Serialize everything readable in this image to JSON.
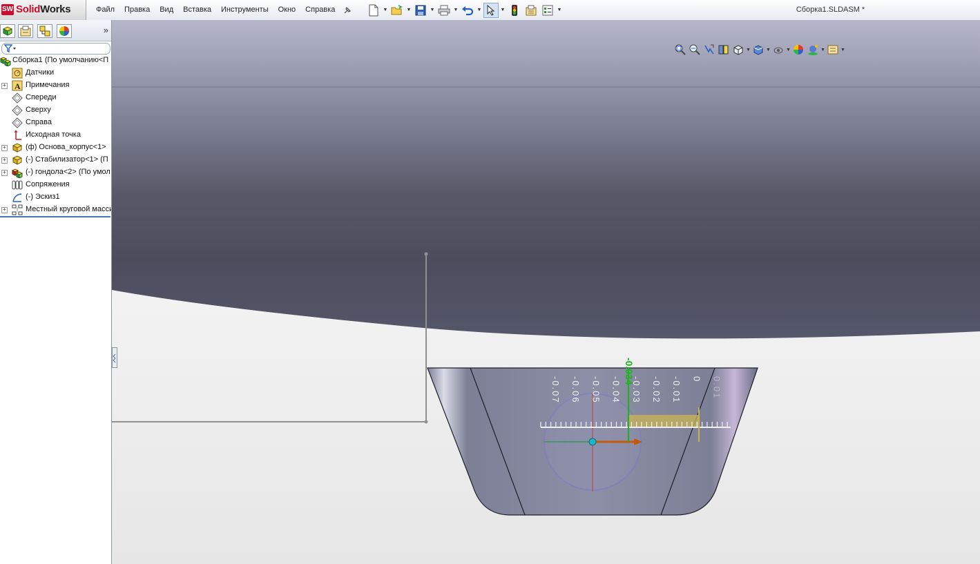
{
  "app": {
    "logo_text_a": "Solid",
    "logo_text_b": "Works",
    "logo_badge": "SW"
  },
  "menu": [
    "Файл",
    "Правка",
    "Вид",
    "Вставка",
    "Инструменты",
    "Окно",
    "Справка"
  ],
  "toolbar_icons": [
    "new-icon",
    "open-icon",
    "save-icon",
    "print-icon",
    "undo-icon",
    "select-icon",
    "rebuild-icon",
    "file-properties-icon",
    "options-icon"
  ],
  "document_title": "Сборка1.SLDASM *",
  "feature_manager": {
    "tabs": [
      "feature-tree-tab-icon",
      "property-manager-tab-icon",
      "configuration-manager-tab-icon",
      "appearance-tab-icon"
    ],
    "expand_glyph": "»",
    "tree": [
      {
        "label": "Сборка1  (По умолчанию<П",
        "icon": "assembly-icon",
        "expandable": false,
        "root": true
      },
      {
        "label": "Датчики",
        "icon": "sensors-icon",
        "expandable": false
      },
      {
        "label": "Примечания",
        "icon": "annotations-icon",
        "expandable": true
      },
      {
        "label": "Спереди",
        "icon": "plane-icon",
        "expandable": false
      },
      {
        "label": "Сверху",
        "icon": "plane-icon",
        "expandable": false
      },
      {
        "label": "Справа",
        "icon": "plane-icon",
        "expandable": false
      },
      {
        "label": "Исходная точка",
        "icon": "origin-icon",
        "expandable": false
      },
      {
        "label": "(ф) Основа_корпус<1>",
        "icon": "part-icon",
        "expandable": true
      },
      {
        "label": "(-) Стабилизатор<1> (П",
        "icon": "part-icon",
        "expandable": true
      },
      {
        "label": "(-) гондола<2> (По умол",
        "icon": "subassembly-icon",
        "expandable": true
      },
      {
        "label": "Сопряжения",
        "icon": "mates-icon",
        "expandable": false
      },
      {
        "label": "(-) Эскиз1",
        "icon": "sketch-icon",
        "expandable": false
      },
      {
        "label": "Местный круговой масси",
        "icon": "circular-pattern-icon",
        "expandable": true
      }
    ]
  },
  "heads_up_toolbar": [
    "zoom-to-fit-icon",
    "zoom-to-area-icon",
    "previous-view-icon",
    "section-view-icon",
    "view-orientation-icon",
    "display-style-icon",
    "hide-show-icon",
    "edit-appearance-icon",
    "apply-scene-icon",
    "view-settings-icon"
  ],
  "ruler": {
    "labels": [
      "-0.07",
      "-0.06",
      "-0.05",
      "-0.04",
      "-0.03",
      "-0.02",
      "-0.01",
      "0",
      "0.01"
    ],
    "current_value": "-0.034"
  },
  "colors": {
    "sky_top": "#b4b5c8",
    "hull_dark": "#4b4d5e",
    "floor": "#e6e6e6",
    "part_mid": "#8d8fa8",
    "ruler_fill": "#c7b257",
    "green": "#1bb41b"
  }
}
